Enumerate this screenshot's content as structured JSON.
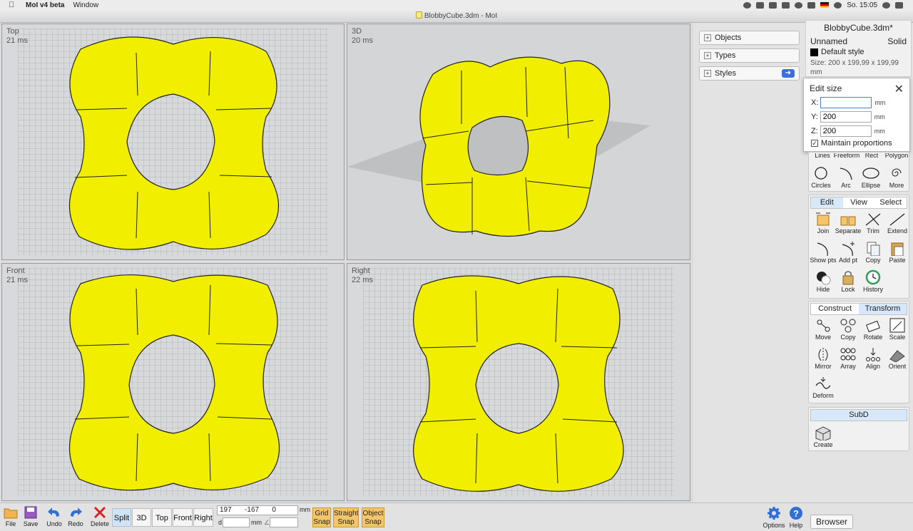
{
  "menubar": {
    "app": "MoI v4 beta",
    "menu": "Window",
    "clock": "So. 15:05"
  },
  "window": {
    "title": "BlobbyCube.3dm - MoI"
  },
  "viewports": [
    {
      "name": "Top",
      "time": "21 ms"
    },
    {
      "name": "3D",
      "time": "20 ms"
    },
    {
      "name": "Front",
      "time": "21 ms"
    },
    {
      "name": "Right",
      "time": "22 ms"
    }
  ],
  "sections": {
    "objects": "Objects",
    "types": "Types",
    "styles": "Styles"
  },
  "properties": {
    "filename": "BlobbyCube.3dm*",
    "name": "Unnamed",
    "kind": "Solid",
    "style": "Default style",
    "size": "Size: 200 x 199,99 x 199,99 mm"
  },
  "editsize": {
    "title": "Edit size",
    "x_label": "X:",
    "y_label": "Y:",
    "z_label": "Z:",
    "x": "",
    "y": "200",
    "z": "200",
    "unit": "mm",
    "maintain": "Maintain proportions"
  },
  "draw_partial": {
    "lines": "Lines",
    "freeform": "Freeform",
    "rect": "Rect",
    "polygon": "Polygon"
  },
  "draw": {
    "circles": "Circles",
    "arc": "Arc",
    "ellipse": "Ellipse",
    "more": "More"
  },
  "edit_tabs": {
    "edit": "Edit",
    "view": "View",
    "select": "Select"
  },
  "edit_tools": {
    "join": "Join",
    "separate": "Separate",
    "trim": "Trim",
    "extend": "Extend",
    "showpts": "Show pts",
    "addpt": "Add pt",
    "copy": "Copy",
    "paste": "Paste",
    "hide": "Hide",
    "lock": "Lock",
    "history": "History"
  },
  "construct_tabs": {
    "construct": "Construct",
    "transform": "Transform"
  },
  "transform_tools": {
    "move": "Move",
    "copy": "Copy",
    "rotate": "Rotate",
    "scale": "Scale",
    "mirror": "Mirror",
    "array": "Array",
    "align": "Align",
    "orient": "Orient",
    "deform": "Deform"
  },
  "subd": {
    "title": "SubD",
    "create": "Create"
  },
  "bottom": {
    "file": "File",
    "save": "Save",
    "undo": "Undo",
    "redo": "Redo",
    "delete": "Delete",
    "split": "Split",
    "v3d": "3D",
    "top": "Top",
    "front": "Front",
    "right": "Right",
    "x": "197",
    "y": "-167",
    "z": "0",
    "unit": "mm",
    "d_label": "d",
    "d_unit": "mm",
    "grid_snap": "Grid Snap",
    "straight_snap": "Straight Snap",
    "object_snap": "Object Snap",
    "options": "Options",
    "help": "Help",
    "browser": "Browser"
  },
  "colors": {
    "model": "#f2ee00",
    "accent": "#3a6fe0",
    "snap": "#f5c56a"
  }
}
